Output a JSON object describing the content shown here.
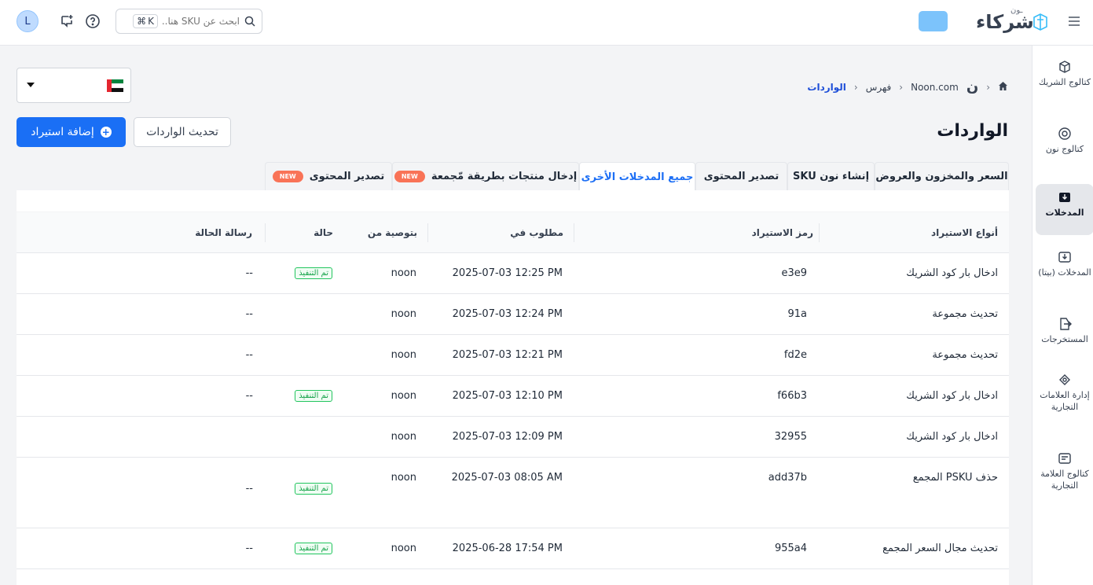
{
  "header": {
    "avatar_initial": "L",
    "search_placeholder": "ابحث عن SKU هنا...",
    "shortcut_key": "K",
    "logo_small": "ـون",
    "logo_big": "شركاء"
  },
  "sidebar": {
    "items": [
      {
        "label": "كتالوج الشريك",
        "icon": "box-icon"
      },
      {
        "label": "كتالوج نون",
        "icon": "noon-catalog-icon"
      },
      {
        "label": "المدخلات",
        "icon": "inbox-icon"
      },
      {
        "label": "المدخلات (بيتا)",
        "icon": "inbox-beta-icon"
      },
      {
        "label": "المستخرجات",
        "icon": "export-icon"
      },
      {
        "label": "إدارة العلامات التجارية",
        "icon": "brand-icon"
      },
      {
        "label": "كتالوج العلامة التجارية",
        "icon": "brand-catalog-icon"
      }
    ]
  },
  "breadcrumb": {
    "noon_glyph": "ن",
    "site": "Noon.com",
    "index": "فهرس",
    "current": "الواردات"
  },
  "page": {
    "title": "الواردات",
    "add_import_label": "إضافة استيراد",
    "refresh_label": "تحديث الواردات"
  },
  "tabs": {
    "price_stock": "السعر والمخزون والعروض",
    "create_sku": "إنشاء نون SKU",
    "export_content": "تصدير المحتوى",
    "all_other": "جميع المدخلات الأخرى",
    "bulk_input": "إدخال منتجات بطريقة مّجمعة",
    "export_content_new": "تصدير المحتوى",
    "new_badge": "NEW"
  },
  "table": {
    "headers": {
      "type": "أنواع الاستيراد",
      "code": "رمز الاستيراد",
      "requested": "مطلوب في",
      "by": "بتوصية من",
      "status": "حالة",
      "message": "رسالة الحالة"
    },
    "rows": [
      {
        "type": "ادخال بار كود الشريك",
        "code": "e3e9",
        "date": "2025-07-03 12:25 PM",
        "by": "noon",
        "status": "تم التنفيذ",
        "message": "--"
      },
      {
        "type": "تحديث مجموعة",
        "code": "91a",
        "date": "2025-07-03 12:24 PM",
        "by": "noon",
        "status": "",
        "message": "--"
      },
      {
        "type": "تحديث مجموعة",
        "code": "fd2e",
        "date": "2025-07-03 12:21 PM",
        "by": "noon",
        "status": "",
        "message": "--"
      },
      {
        "type": "ادخال بار كود الشريك",
        "code": "f66b3",
        "date": "2025-07-03 12:10 PM",
        "by": "noon",
        "status": "تم التنفيذ",
        "message": "--"
      },
      {
        "type": "ادخال بار كود الشريك",
        "code": "32955",
        "date": "2025-07-03 12:09 PM",
        "by": "noon",
        "status": "",
        "message": ""
      },
      {
        "type": "حذف PSKU المجمع",
        "code": "add37b",
        "date": "2025-07-03 08:05 AM",
        "by": "noon",
        "status": "تم التنفيذ",
        "message": "--"
      },
      {
        "type": "تحديث مجال السعر المجمع",
        "code": "955a4",
        "date": "2025-06-28 17:54 PM",
        "by": "noon",
        "status": "تم التنفيذ",
        "message": "--"
      }
    ]
  },
  "colors": {
    "primary": "#1a6ff5",
    "success": "#16a34a",
    "badge": "#f97357"
  }
}
